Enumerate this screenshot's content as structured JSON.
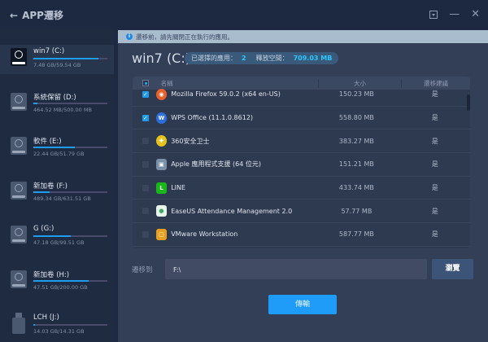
{
  "app": {
    "title": "APP遷移"
  },
  "drives": [
    {
      "name": "win7 (C:)",
      "usage": "7.48 GB/59.54 GB",
      "fill": 0.88,
      "selected": true,
      "type": "disk"
    },
    {
      "name": "系統保留 (D:)",
      "usage": "464.52 MB/500.00 MB",
      "fill": 0.05,
      "type": "disk"
    },
    {
      "name": "軟件 (E:)",
      "usage": "22.44 GB/51.79 GB",
      "fill": 0.56,
      "type": "disk"
    },
    {
      "name": "新加卷 (F:)",
      "usage": "489.34 GB/631.51 GB",
      "fill": 0.22,
      "type": "disk"
    },
    {
      "name": "G (G:)",
      "usage": "47.18 GB/99.51 GB",
      "fill": 0.51,
      "type": "disk"
    },
    {
      "name": "新加卷 (H:)",
      "usage": "47.51 GB/200.00 GB",
      "fill": 0.75,
      "type": "disk"
    },
    {
      "name": "LCH (J:)",
      "usage": "14.03 GB/14.31 GB",
      "fill": 0.02,
      "type": "usb"
    }
  ],
  "banner": "遷移前，請先關閉正在執行的應用。",
  "header": {
    "title": "win7 (C:)",
    "selected_label": "已選擇的應用：",
    "selected_count": "2",
    "free_label": "釋放空間：",
    "free_value": "709.03 MB"
  },
  "table": {
    "columns": [
      "名稱",
      "大小",
      "遷移建議"
    ],
    "rows": [
      {
        "name": "Mozilla Firefox 59.0.2 (x64 en-US)",
        "size": "150.23 MB",
        "rec": "是",
        "checked": true,
        "icon": "firefox-icon",
        "color": "#e8602c"
      },
      {
        "name": "WPS Office (11.1.0.8612)",
        "size": "558.80 MB",
        "rec": "是",
        "checked": true,
        "icon": "wps-icon",
        "color": "#2d6fe0"
      },
      {
        "name": "360安全卫士",
        "size": "383.27 MB",
        "rec": "是",
        "checked": false,
        "icon": "360-icon",
        "color": "#e6c21c"
      },
      {
        "name": "Apple 應用程式支援 (64 位元)",
        "size": "151.21 MB",
        "rec": "是",
        "checked": false,
        "icon": "apple-icon",
        "color": "#7a8fa8"
      },
      {
        "name": "LINE",
        "size": "433.74 MB",
        "rec": "是",
        "checked": false,
        "icon": "line-icon",
        "color": "#18b818"
      },
      {
        "name": "EaseUS Attendance Management 2.0",
        "size": "57.77 MB",
        "rec": "是",
        "checked": false,
        "icon": "easeus-icon",
        "color": "#e8f3ea"
      },
      {
        "name": "VMware Workstation",
        "size": "587.77 MB",
        "rec": "是",
        "checked": false,
        "icon": "vmware-icon",
        "color": "#e8a020"
      }
    ]
  },
  "destination": {
    "label": "遷移到",
    "value": "F:\\",
    "browse": "瀏覽"
  },
  "transfer": "傳輸"
}
